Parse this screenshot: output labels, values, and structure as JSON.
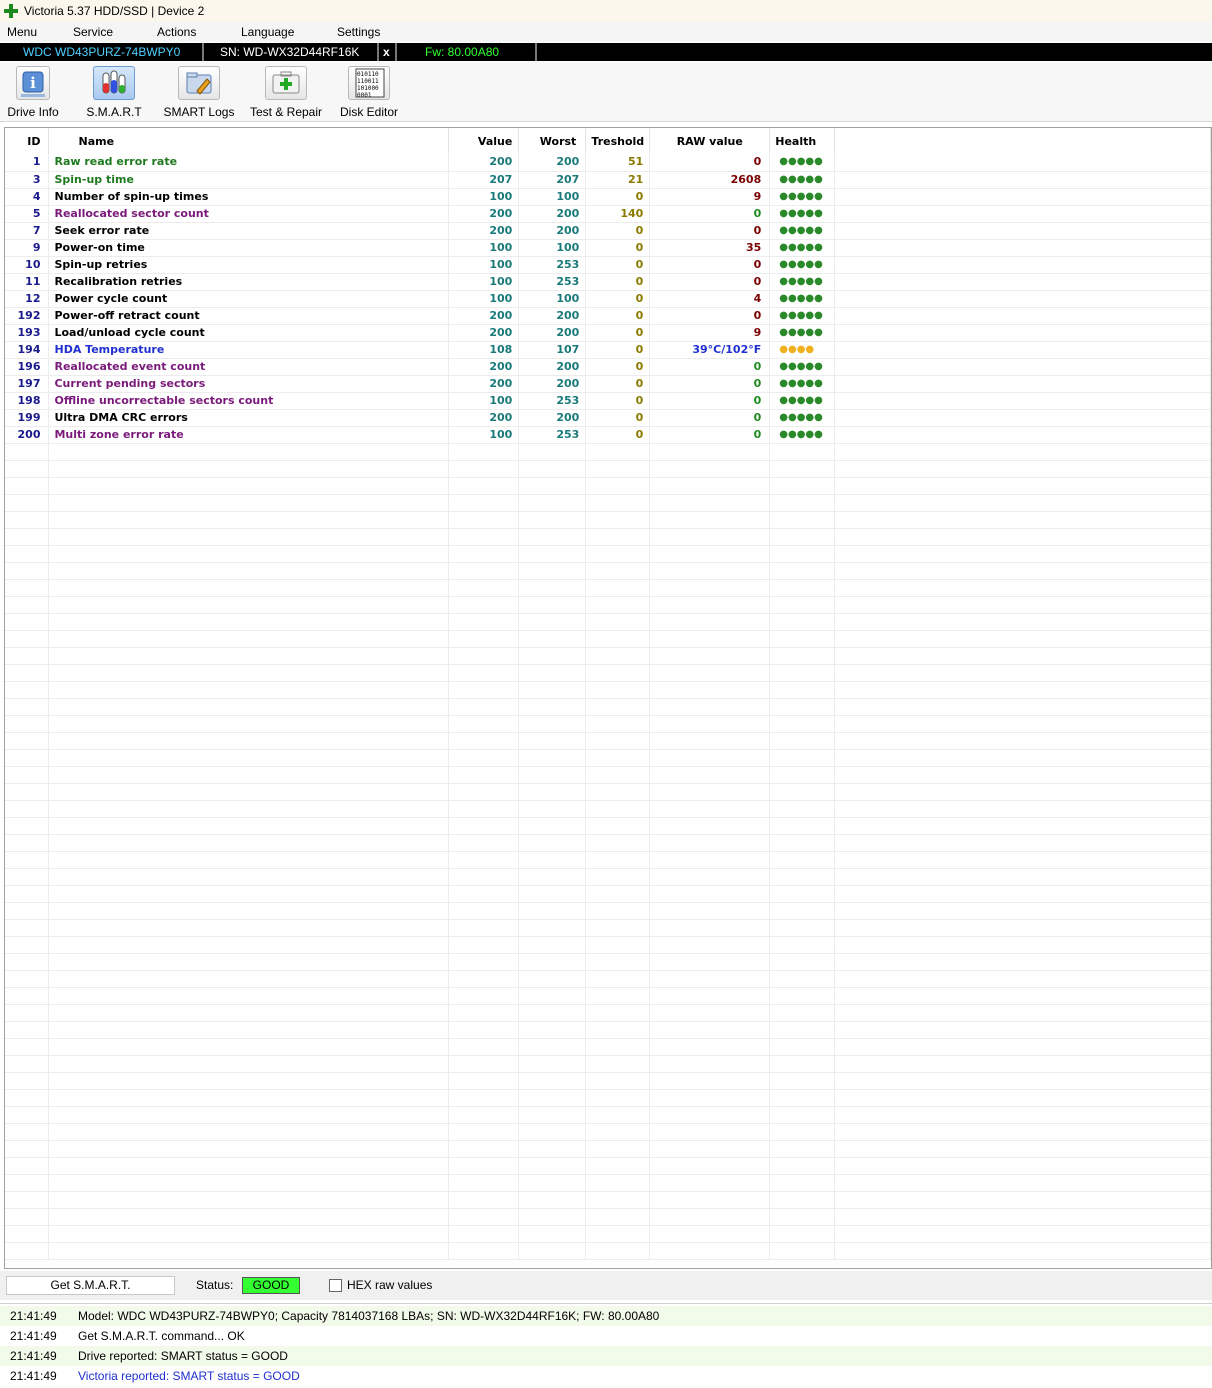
{
  "window": {
    "title": "Victoria 5.37 HDD/SSD | Device 2"
  },
  "menu": [
    "Menu",
    "Service",
    "Actions",
    "Language",
    "Settings"
  ],
  "device": {
    "model": "WDC WD43PURZ-74BWPY0",
    "serial": "SN: WD-WX32D44RF16K",
    "close": "x",
    "firmware": "Fw: 80.00A80"
  },
  "toolbar": {
    "drive_info": "Drive Info",
    "smart": "S.M.A.R.T",
    "smart_logs": "SMART Logs",
    "test_repair": "Test & Repair",
    "disk_editor": "Disk Editor",
    "disk_editor_icon_text": "010110 110011 101000 0001"
  },
  "columns": [
    "ID",
    "Name",
    "Value",
    "Worst",
    "Treshold",
    "RAW value",
    "Health"
  ],
  "attributes": [
    {
      "id": "1",
      "name": "Raw read error rate",
      "value": "200",
      "worst": "200",
      "threshold": "51",
      "raw": "0",
      "health": "●●●●●",
      "name_color": "green",
      "raw_color": "dark",
      "health_color": "green"
    },
    {
      "id": "3",
      "name": "Spin-up time",
      "value": "207",
      "worst": "207",
      "threshold": "21",
      "raw": "2608",
      "health": "●●●●●",
      "name_color": "green",
      "raw_color": "dark",
      "health_color": "green"
    },
    {
      "id": "4",
      "name": "Number of spin-up times",
      "value": "100",
      "worst": "100",
      "threshold": "0",
      "raw": "9",
      "health": "●●●●●",
      "name_color": "black",
      "raw_color": "dark",
      "health_color": "green"
    },
    {
      "id": "5",
      "name": "Reallocated sector count",
      "value": "200",
      "worst": "200",
      "threshold": "140",
      "raw": "0",
      "health": "●●●●●",
      "name_color": "purple",
      "raw_color": "green",
      "health_color": "green"
    },
    {
      "id": "7",
      "name": "Seek error rate",
      "value": "200",
      "worst": "200",
      "threshold": "0",
      "raw": "0",
      "health": "●●●●●",
      "name_color": "black",
      "raw_color": "dark",
      "health_color": "green"
    },
    {
      "id": "9",
      "name": "Power-on time",
      "value": "100",
      "worst": "100",
      "threshold": "0",
      "raw": "35",
      "health": "●●●●●",
      "name_color": "black",
      "raw_color": "dark",
      "health_color": "green"
    },
    {
      "id": "10",
      "name": "Spin-up retries",
      "value": "100",
      "worst": "253",
      "threshold": "0",
      "raw": "0",
      "health": "●●●●●",
      "name_color": "black",
      "raw_color": "dark",
      "health_color": "green"
    },
    {
      "id": "11",
      "name": "Recalibration retries",
      "value": "100",
      "worst": "253",
      "threshold": "0",
      "raw": "0",
      "health": "●●●●●",
      "name_color": "black",
      "raw_color": "dark",
      "health_color": "green"
    },
    {
      "id": "12",
      "name": "Power cycle count",
      "value": "100",
      "worst": "100",
      "threshold": "0",
      "raw": "4",
      "health": "●●●●●",
      "name_color": "black",
      "raw_color": "dark",
      "health_color": "green"
    },
    {
      "id": "192",
      "name": "Power-off retract count",
      "value": "200",
      "worst": "200",
      "threshold": "0",
      "raw": "0",
      "health": "●●●●●",
      "name_color": "black",
      "raw_color": "dark",
      "health_color": "green"
    },
    {
      "id": "193",
      "name": "Load/unload cycle count",
      "value": "200",
      "worst": "200",
      "threshold": "0",
      "raw": "9",
      "health": "●●●●●",
      "name_color": "black",
      "raw_color": "dark",
      "health_color": "green"
    },
    {
      "id": "194",
      "name": "HDA Temperature",
      "value": "108",
      "worst": "107",
      "threshold": "0",
      "raw": "39°C/102°F",
      "health": "●●●●",
      "name_color": "blue",
      "raw_color": "blue",
      "health_color": "yellow"
    },
    {
      "id": "196",
      "name": "Reallocated event count",
      "value": "200",
      "worst": "200",
      "threshold": "0",
      "raw": "0",
      "health": "●●●●●",
      "name_color": "purple",
      "raw_color": "green",
      "health_color": "green"
    },
    {
      "id": "197",
      "name": "Current pending sectors",
      "value": "200",
      "worst": "200",
      "threshold": "0",
      "raw": "0",
      "health": "●●●●●",
      "name_color": "purple",
      "raw_color": "green",
      "health_color": "green"
    },
    {
      "id": "198",
      "name": "Offline uncorrectable sectors count",
      "value": "100",
      "worst": "253",
      "threshold": "0",
      "raw": "0",
      "health": "●●●●●",
      "name_color": "purple",
      "raw_color": "green",
      "health_color": "green"
    },
    {
      "id": "199",
      "name": "Ultra DMA CRC errors",
      "value": "200",
      "worst": "200",
      "threshold": "0",
      "raw": "0",
      "health": "●●●●●",
      "name_color": "black",
      "raw_color": "green",
      "health_color": "green"
    },
    {
      "id": "200",
      "name": "Multi zone error rate",
      "value": "100",
      "worst": "253",
      "threshold": "0",
      "raw": "0",
      "health": "●●●●●",
      "name_color": "purple",
      "raw_color": "green",
      "health_color": "green"
    }
  ],
  "statusbar": {
    "get_smart": "Get S.M.A.R.T.",
    "status_label": "Status:",
    "status_value": "GOOD",
    "status_color": "#33ff33",
    "hex_label": "HEX raw values",
    "hex_checked": false
  },
  "log": [
    {
      "time": "21:41:49",
      "message": "Model: WDC WD43PURZ-74BWPY0; Capacity 7814037168 LBAs; SN: WD-WX32D44RF16K; FW: 80.00A80",
      "color": "#000000"
    },
    {
      "time": "21:41:49",
      "message": "Get S.M.A.R.T. command... OK",
      "color": "#000000"
    },
    {
      "time": "21:41:49",
      "message": "Drive reported: SMART status = GOOD",
      "color": "#000000"
    },
    {
      "time": "21:41:49",
      "message": "Victoria reported: SMART status = GOOD",
      "color": "#2030d0"
    }
  ]
}
